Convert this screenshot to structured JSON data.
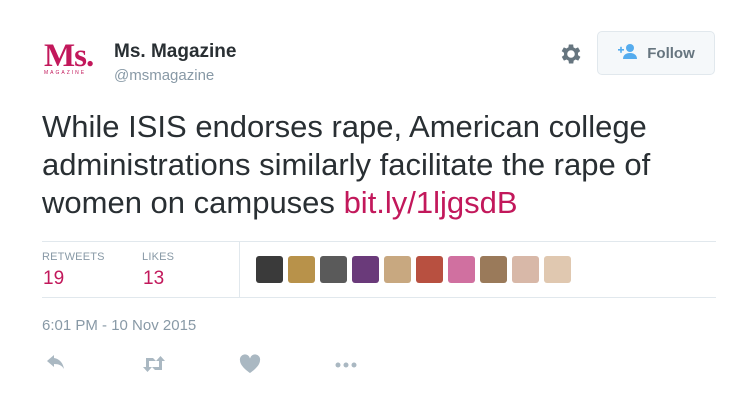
{
  "profile": {
    "logo_text": "Ms.",
    "logo_subtext": "MAGAZINE",
    "display_name": "Ms. Magazine",
    "handle": "@msmagazine"
  },
  "follow_label": "Follow",
  "tweet": {
    "text": "While ISIS endorses rape, American college administrations similarly facilitate the rape of women on campuses",
    "link": "bit.ly/1ljgsdB"
  },
  "stats": {
    "retweets_label": "RETWEETS",
    "retweets_value": "19",
    "likes_label": "LIKES",
    "likes_value": "13"
  },
  "likers": [
    {
      "color": "#3a3a3a"
    },
    {
      "color": "#b8924a"
    },
    {
      "color": "#5a5a5a"
    },
    {
      "color": "#6a3a7a"
    },
    {
      "color": "#c8a880"
    },
    {
      "color": "#b85040"
    },
    {
      "color": "#d070a0"
    },
    {
      "color": "#9a7a5a"
    },
    {
      "color": "#d8b8a8"
    },
    {
      "color": "#e0c8b0"
    }
  ],
  "timestamp": "6:01 PM - 10 Nov 2015",
  "icons": {
    "gear": "gear-icon",
    "follow": "add-user-icon",
    "reply": "reply-icon",
    "retweet": "retweet-icon",
    "like": "heart-icon",
    "more": "more-icon"
  },
  "colors": {
    "accent": "#c2185b",
    "muted": "#8899a6",
    "text": "#292f33"
  }
}
